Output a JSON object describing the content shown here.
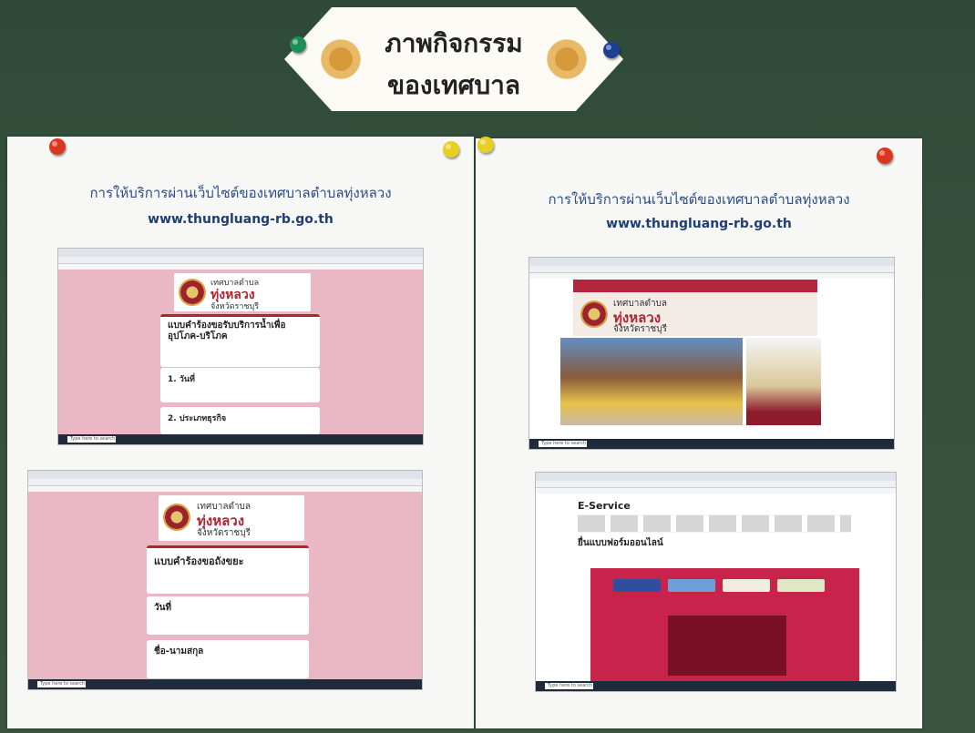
{
  "sign": {
    "line1": "ภาพกิจกรรม",
    "line2": "ของเทศบาล"
  },
  "posters": [
    {
      "title": "การให้บริการผ่านเว็บไซต์ของเทศบาลตำบลทุ่งหลวง",
      "url": "www.thungluang-rb.go.th"
    },
    {
      "title": "การให้บริการผ่านเว็บไซต์ของเทศบาลตำบลทุ่งหลวง",
      "url": "www.thungluang-rb.go.th"
    }
  ],
  "banner": {
    "l1": "เทศบาลตำบล",
    "l2": "ทุ่งหลวง",
    "l3": "จังหวัดราชบุรี"
  },
  "form1": {
    "title": "แบบคำร้องขอรับบริการน้ำเพื่ออุปโภค-บริโภค",
    "q1": "1. วันที่",
    "q2": "2. ประเภทธุรกิจ"
  },
  "form2": {
    "title": "แบบคำร้องขอถังขยะ",
    "q1": "วันที่",
    "q2": "ชื่อ-นามสกุล"
  },
  "eservice": {
    "title": "E-Service",
    "subtitle": "ยื่นแบบฟอร์มออนไลน์"
  },
  "taskbar": {
    "search": "Type here to search"
  },
  "colors": {
    "pink": "#e9b8c4",
    "brand_red": "#b0242f",
    "link_blue": "#2b4d8a"
  }
}
